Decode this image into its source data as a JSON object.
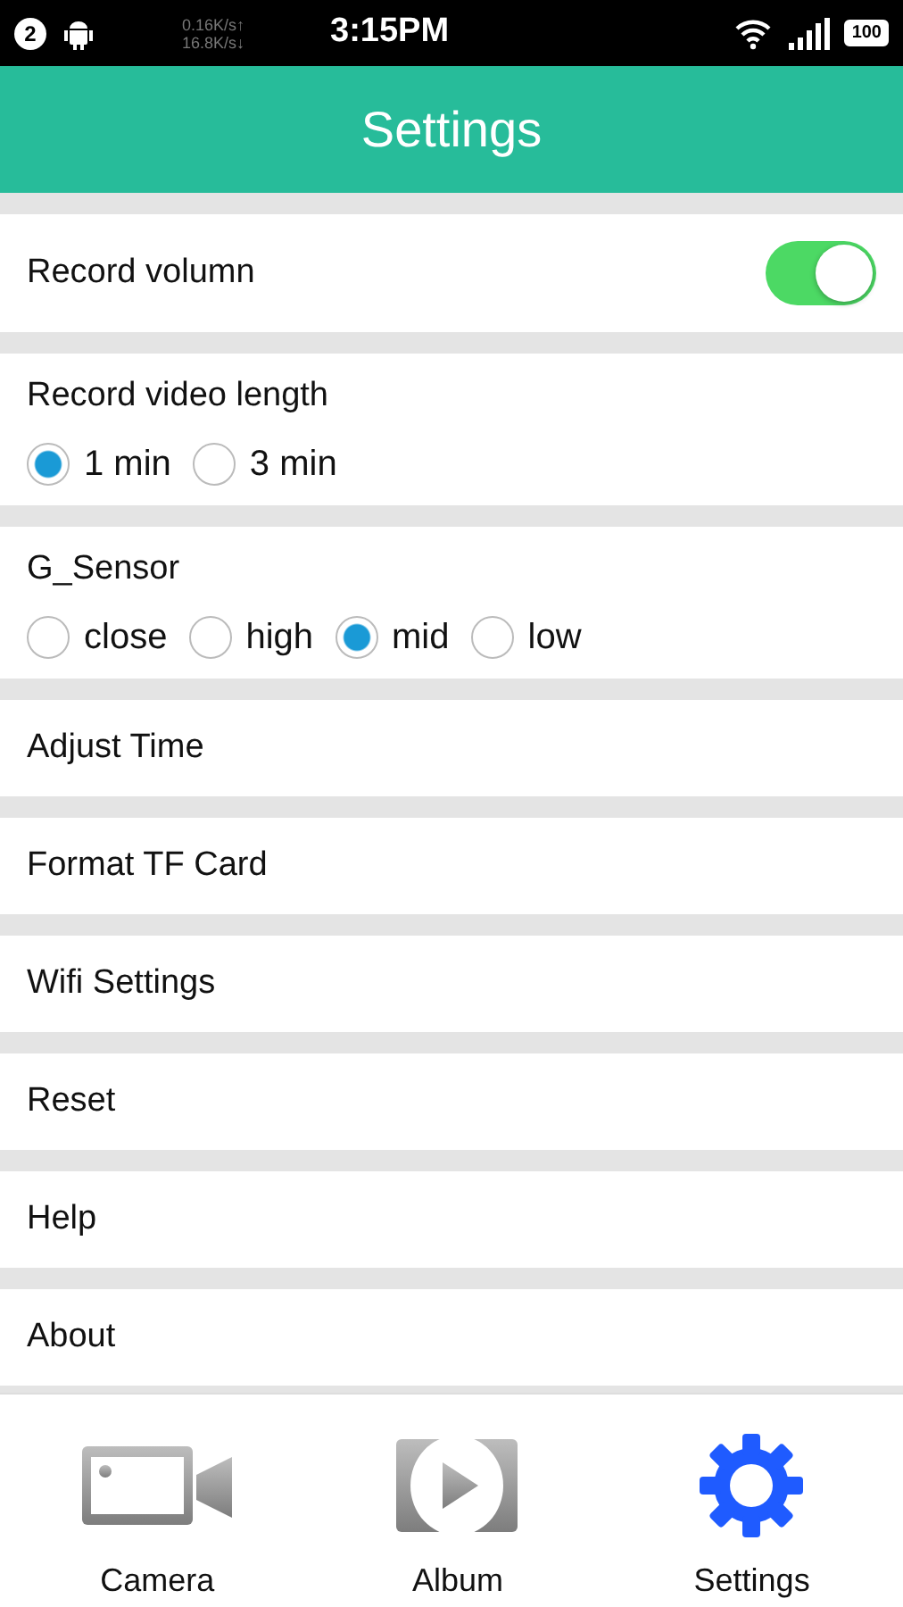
{
  "status_bar": {
    "notification_count": "2",
    "upload_speed": "0.16K/s↑",
    "download_speed": "16.8K/s↓",
    "time": "3:15PM",
    "battery": "100"
  },
  "header": {
    "title": "Settings"
  },
  "settings": [
    {
      "kind": "toggle",
      "label": "Record volumn",
      "on": true
    },
    {
      "kind": "radio",
      "label": "Record video length",
      "options": [
        {
          "label": "1 min",
          "selected": true
        },
        {
          "label": "3 min",
          "selected": false
        }
      ]
    },
    {
      "kind": "radio",
      "label": "G_Sensor",
      "options": [
        {
          "label": "close",
          "selected": false
        },
        {
          "label": "high",
          "selected": false
        },
        {
          "label": "mid",
          "selected": true
        },
        {
          "label": "low",
          "selected": false
        }
      ]
    },
    {
      "kind": "link",
      "label": "Adjust Time"
    },
    {
      "kind": "link",
      "label": "Format TF Card"
    },
    {
      "kind": "link",
      "label": "Wifi Settings"
    },
    {
      "kind": "link",
      "label": "Reset"
    },
    {
      "kind": "link",
      "label": "Help"
    },
    {
      "kind": "link",
      "label": "About"
    }
  ],
  "bottom_nav": [
    {
      "kind": "camera",
      "label": "Camera",
      "selected": false
    },
    {
      "kind": "album",
      "label": "Album",
      "selected": false
    },
    {
      "kind": "settings",
      "label": "Settings",
      "selected": true
    }
  ]
}
